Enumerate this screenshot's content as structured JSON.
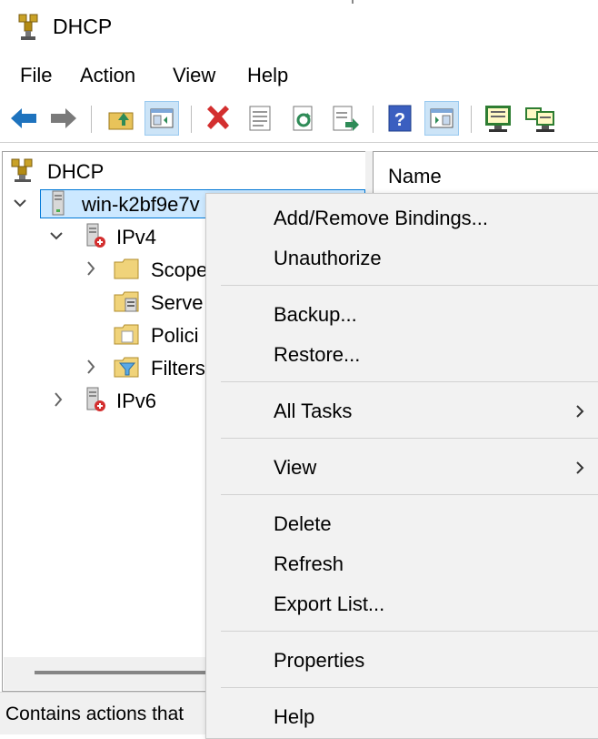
{
  "window": {
    "title": "DHCP"
  },
  "menubar": {
    "items": [
      "File",
      "Action",
      "View",
      "Help"
    ]
  },
  "toolbar": {
    "buttons": [
      "back-arrow-icon",
      "forward-arrow-icon",
      "up-one-level-icon",
      "show-hide-console-tree-icon",
      "delete-icon",
      "properties-icon",
      "refresh-icon",
      "export-list-icon",
      "help-icon",
      "show-hide-action-pane-icon",
      "server-statistics-icon",
      "server-options-icon"
    ],
    "accent_color": "#1e73be",
    "delete_color": "#d32f2f"
  },
  "tree": {
    "root": "DHCP",
    "server": "win-k2bf9e7v",
    "ipv4": "IPv4",
    "scope": "Scope",
    "server_options": "Serve",
    "policies": "Polici",
    "filters": "Filters",
    "ipv6": "IPv6"
  },
  "list": {
    "column_name": "Name"
  },
  "status": {
    "text": "Contains actions that"
  },
  "context_menu": {
    "items": [
      "Add/Remove Bindings...",
      "Unauthorize",
      "Backup...",
      "Restore...",
      "All Tasks",
      "View",
      "Delete",
      "Refresh",
      "Export List...",
      "Properties",
      "Help"
    ]
  }
}
